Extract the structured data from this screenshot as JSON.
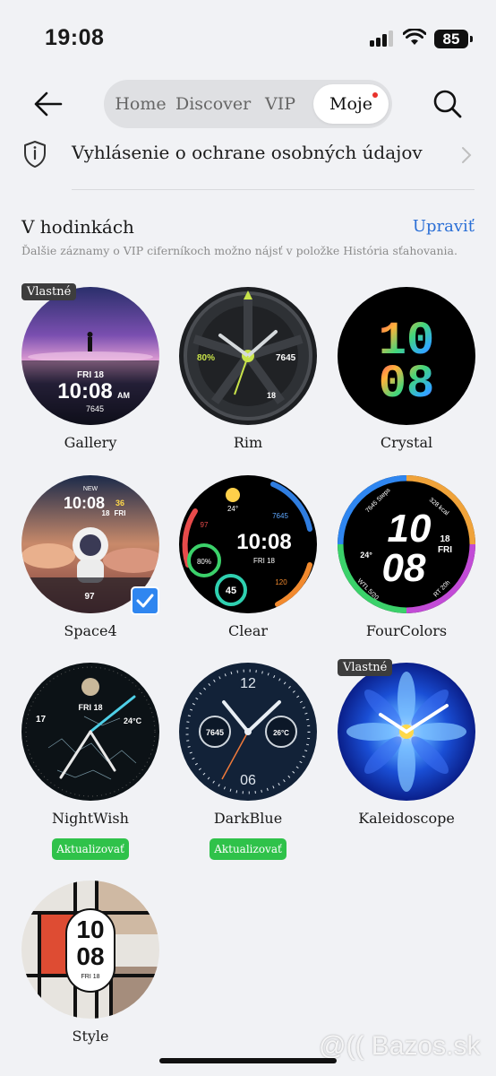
{
  "status_bar": {
    "time": "19:08",
    "battery": "85"
  },
  "header": {
    "tabs": [
      {
        "label": "Home"
      },
      {
        "label": "Discover"
      },
      {
        "label": "VIP"
      },
      {
        "label": "Moje",
        "active": true
      }
    ]
  },
  "privacy": {
    "label": "Vyhlásenie o ochrane osobných údajov"
  },
  "section": {
    "title": "V hodinkách",
    "edit_label": "Upraviť",
    "hint": "Ďalšie záznamy o VIP ciferníkoch možno nájsť v položke História sťahovania."
  },
  "faces": [
    {
      "name": "Gallery",
      "tag": "Vlastné",
      "dial_text": [
        "FRI 18",
        "10:08",
        "AM",
        "7645"
      ]
    },
    {
      "name": "Rim",
      "dial_text": [
        "80%",
        "7645",
        "18"
      ]
    },
    {
      "name": "Crystal",
      "dial_text": [
        "10",
        "08"
      ]
    },
    {
      "name": "Space4",
      "selected": true,
      "dial_text": [
        "NEW",
        "10:08",
        "FRI",
        "36",
        "18",
        "97"
      ]
    },
    {
      "name": "Clear",
      "dial_text": [
        "24°",
        "7645",
        "97",
        "10:08",
        "FRI 18",
        "80%",
        "45",
        "120"
      ]
    },
    {
      "name": "FourColors",
      "dial_text": [
        "7645 Steps",
        "328 kcal",
        "10",
        "08",
        "24°",
        "18",
        "FRI",
        "WTL 5/20",
        "RT 20h"
      ]
    },
    {
      "name": "NightWish",
      "update_label": "Aktualizovať",
      "dial_text": [
        "FRI 18",
        "17",
        "24°C"
      ]
    },
    {
      "name": "DarkBlue",
      "update_label": "Aktualizovať",
      "dial_text": [
        "12",
        "06",
        "7645",
        "26°C"
      ]
    },
    {
      "name": "Kaleidoscope",
      "tag": "Vlastné"
    },
    {
      "name": "Style",
      "dial_text": [
        "10",
        "08",
        "FRI 18"
      ]
    }
  ],
  "watermark": "@(( Bazos.sk"
}
